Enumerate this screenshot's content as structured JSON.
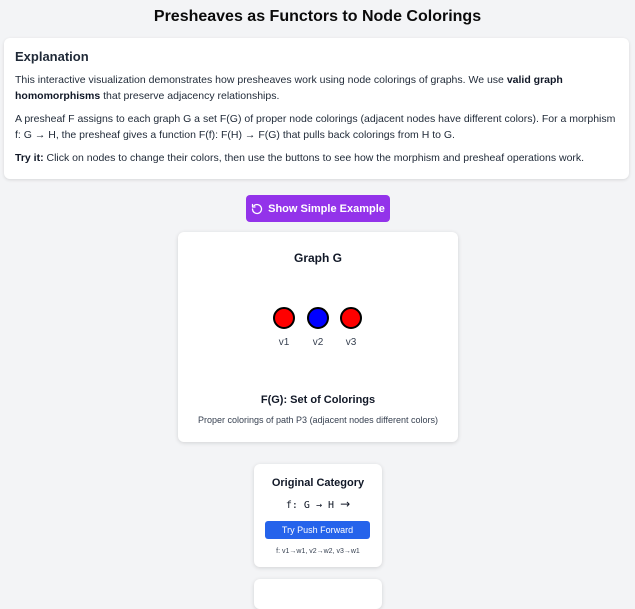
{
  "page": {
    "title": "Presheaves as Functors to Node Colorings"
  },
  "explanation": {
    "heading": "Explanation",
    "p1_pre": "This interactive visualization demonstrates how presheaves work using node colorings of graphs. We use ",
    "p1_bold": "valid graph homomorphisms",
    "p1_post": " that preserve adjacency relationships.",
    "p2": "A presheaf F assigns to each graph G a set F(G) of proper node colorings (adjacent nodes have different colors). For a morphism f: G → H, the presheaf gives a function F(f): F(H) → F(G) that pulls back colorings from H to G.",
    "p3_bold": "Try it:",
    "p3_post": " Click on nodes to change their colors, then use the buttons to see how the morphism and presheaf operations work."
  },
  "example_button": {
    "label": "Show Simple Example",
    "icon": "rotate-ccw-icon",
    "color": "#9333ea"
  },
  "graph_g": {
    "title": "Graph G",
    "nodes": [
      {
        "label": "v1",
        "color": "#ff0000"
      },
      {
        "label": "v2",
        "color": "#0000ff"
      },
      {
        "label": "v3",
        "color": "#ff0000"
      }
    ],
    "fg_title": "F(G): Set of Colorings",
    "fg_desc": "Proper colorings of path P3 (adjacent nodes different colors)"
  },
  "original_category": {
    "title": "Original Category",
    "morphism": "f: G → H",
    "arrow_icon": "→",
    "push_button": "Try Push Forward",
    "push_button_color": "#2563eb",
    "mapping": "f: v1→w1, v2→w2, v3→w1"
  }
}
